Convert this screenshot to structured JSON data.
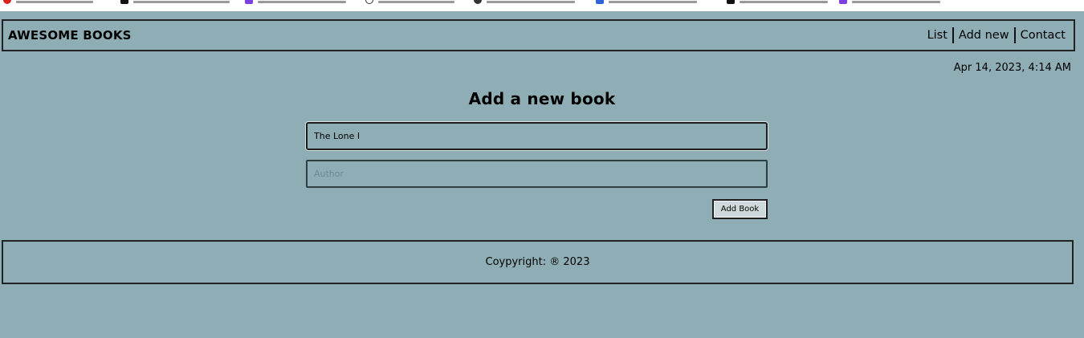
{
  "colors": {
    "page_background": "#8fadb5",
    "border": "#222222",
    "text": "#000000"
  },
  "bookmarks_bar": {
    "icons": [
      "red-circle-icon",
      "black-square-icon",
      "purple-square-icon",
      "github-icon",
      "code-icon",
      "blue-square-icon",
      "black-square-icon",
      "purple-square-icon"
    ]
  },
  "header": {
    "logo": "AWESOME BOOKS",
    "nav": [
      "List",
      "Add new",
      "Contact"
    ]
  },
  "datetime": "Apr 14, 2023, 4:14 AM",
  "form": {
    "title_heading": "Add a new book",
    "title_value": "The Lone I",
    "author_value": "",
    "author_placeholder": "Author",
    "submit_label": "Add Book"
  },
  "footer": {
    "text": "Coypyright: ® 2023"
  }
}
